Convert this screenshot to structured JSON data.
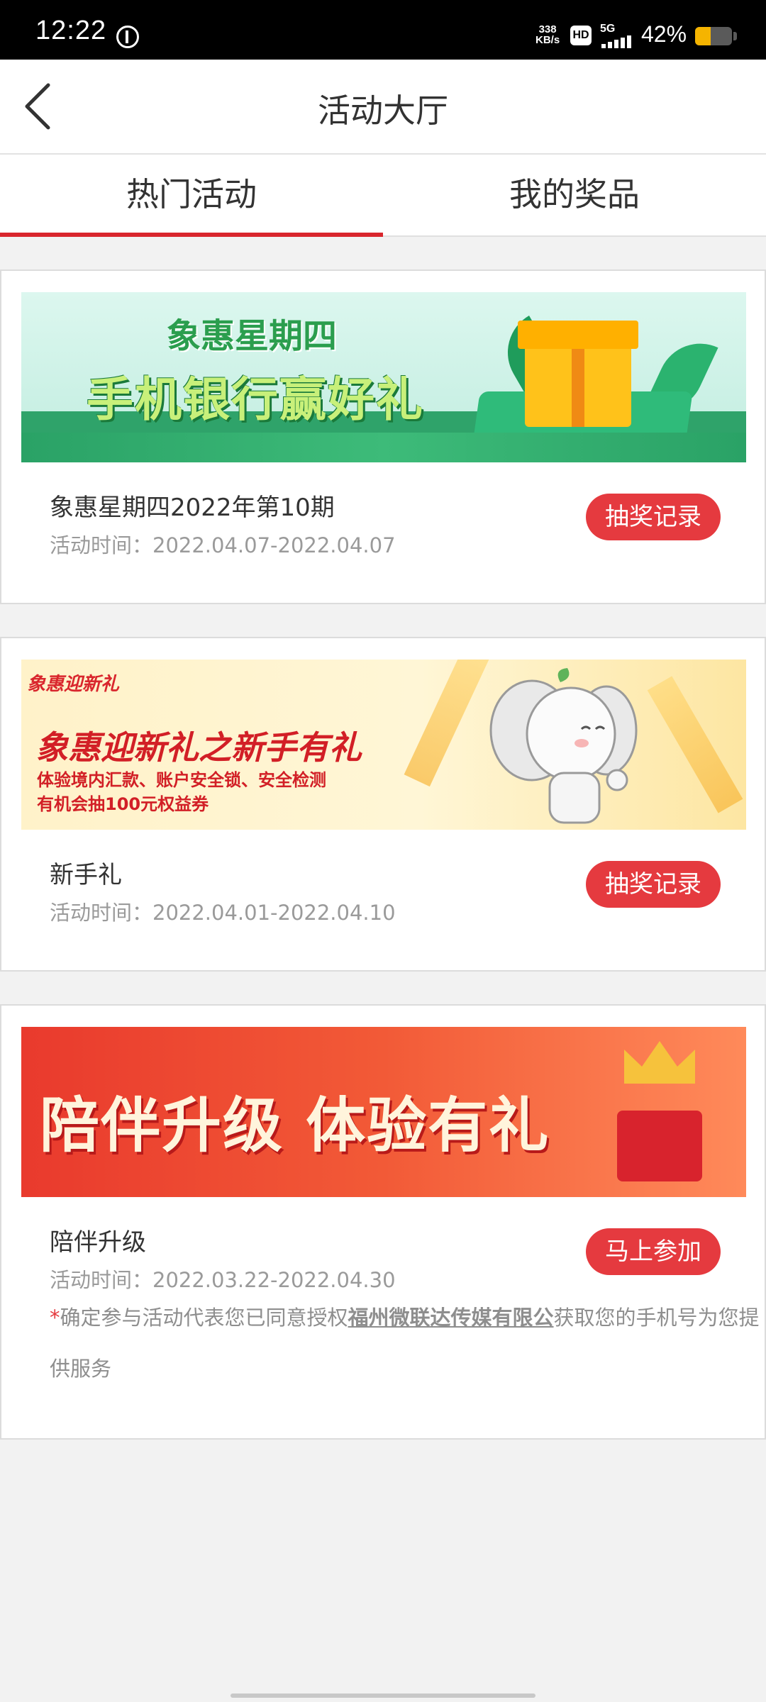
{
  "status_bar": {
    "time": "12:22",
    "speed_value": "338",
    "speed_unit": "KB/s",
    "hd_label": "HD",
    "network": "5G",
    "battery_percent": "42%",
    "battery_level": 0.42,
    "battery_color": "#f5b400"
  },
  "header": {
    "title": "活动大厅",
    "back_icon": "chevron-left-icon"
  },
  "tabs": [
    {
      "label": "热门活动",
      "active": true
    },
    {
      "label": "我的奖品",
      "active": false
    }
  ],
  "accent_color": "#d9262d",
  "button_color": "#e53a3f",
  "activities": [
    {
      "banner": {
        "subtitle": "象惠星期四",
        "title": "手机银行赢好礼"
      },
      "name": "象惠星期四2022年第10期",
      "time": "活动时间：2022.04.07-2022.04.07",
      "button": "抽奖记录"
    },
    {
      "banner": {
        "logo": "象惠迎新礼",
        "title": "象惠迎新礼之新手有礼",
        "line1": "体验境内汇款、账户安全锁、安全检测",
        "line2": "有机会抽100元权益券"
      },
      "name": "新手礼",
      "time": "活动时间：2022.04.01-2022.04.10",
      "button": "抽奖记录"
    },
    {
      "banner": {
        "title": "陪伴升级 体验有礼"
      },
      "name": "陪伴升级",
      "time": "活动时间：2022.03.22-2022.04.30",
      "button": "马上参加",
      "notice": {
        "star": "*",
        "before": "确定参与活动代表您已同意授权",
        "link": "福州微联达传媒有限公",
        "after": "获取您的手机号为您提供服务"
      }
    }
  ]
}
